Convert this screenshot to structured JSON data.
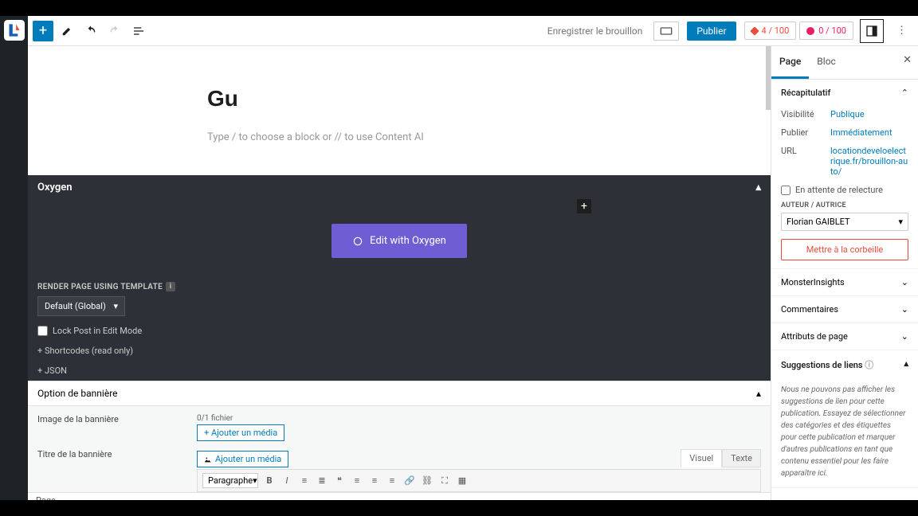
{
  "topbar": {
    "save_draft": "Enregistrer le brouillon",
    "publish": "Publier",
    "score1": "4 / 100",
    "score2": "0 / 100"
  },
  "editor": {
    "title": "Gu",
    "placeholder": "Type / to choose a block or // to use Content AI"
  },
  "oxygen": {
    "header": "Oxygen",
    "edit_btn": "Edit with Oxygen",
    "render_label": "RENDER PAGE USING TEMPLATE",
    "template": "Default (Global)",
    "lock_label": "Lock Post in Edit Mode",
    "shortcodes": "+ Shortcodes (read only)",
    "json": "+ JSON"
  },
  "banner": {
    "header": "Option de bannière",
    "image_label": "Image de la bannière",
    "file_count": "0/1 fichier",
    "add_media": "+ Ajouter un média",
    "title_label": "Titre de la bannière",
    "add_media2": "Ajouter un média",
    "tab_visual": "Visuel",
    "tab_text": "Texte",
    "paragraph": "Paragraphe"
  },
  "footer": {
    "status": "Page"
  },
  "sidebar": {
    "tab_page": "Page",
    "tab_block": "Bloc",
    "summary": {
      "title": "Récapitulatif",
      "visibility_k": "Visibilité",
      "visibility_v": "Publique",
      "publish_k": "Publier",
      "publish_v": "Immédiatement",
      "url_k": "URL",
      "url_v": "locationdeveloelectrique.fr/brouillon-auto/",
      "pending": "En attente de relecture",
      "author_label": "AUTEUR / AUTRICE",
      "author": "Florian GAIBLET",
      "trash": "Mettre à la corbeille"
    },
    "monster": "MonsterInsights",
    "comments": "Commentaires",
    "attrs": "Attributs de page",
    "links": {
      "title": "Suggestions de liens",
      "body": "Nous ne pouvons pas afficher les suggestions de lien pour cette publication. Essayez de sélectionner des catégories et des étiquettes pour cette publication et marquer d'autres publications en tant que contenu essentiel pour les faire apparaître ici."
    }
  }
}
